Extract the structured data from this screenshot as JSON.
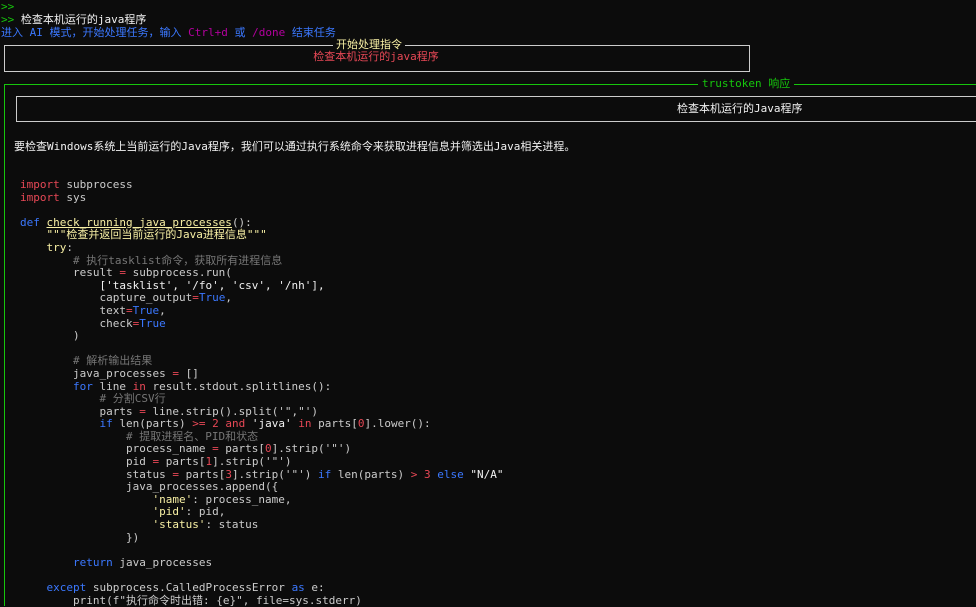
{
  "terminal": {
    "prompt_empty": ">>",
    "prompt_symbol": ">>",
    "user_command": "检查本机运行的java程序",
    "mode_notice_prefix": "进入 AI 模式，开始处理任务，输入 ",
    "mode_notice_key": "Ctrl+d",
    "mode_notice_or": " 或 ",
    "mode_notice_done": "/done",
    "mode_notice_suffix": " 结束任务"
  },
  "instruction_box": {
    "title": "开始处理指令",
    "content": "检查本机运行的java程序"
  },
  "response_panel": {
    "title": "trustoken 响应",
    "heading": "检查本机运行的Java程序",
    "intro": "要检查Windows系统上当前运行的Java程序，我们可以通过执行系统命令来获取进程信息并筛选出Java相关进程。"
  },
  "code": {
    "l1_kw": "import",
    "l1_mod": " subprocess",
    "l2_kw": "import",
    "l2_mod": " sys",
    "l3_kw": "def",
    "l3_fn": "check_running_java_processes",
    "l3_rest": "():",
    "l4_doc": "\"\"\"检查并返回当前运行的Java进程信息\"\"\"",
    "l5_kw": "try",
    "l6_cm": "# 执行tasklist命令，获取所有进程信息",
    "l7_a": "result ",
    "l7_b": " subprocess.run(",
    "l8_a": "['tasklist', '/fo', 'csv', '/nh'],",
    "l9_a": "capture_output",
    "l9_b": "True",
    "l10_a": "text",
    "l10_b": "True",
    "l11_a": "check",
    "l11_b": "True",
    "l12": ")",
    "l13_cm": "# 解析输出结果",
    "l14_a": "java_processes ",
    "l14_b": " []",
    "l15_for": "for",
    "l15_a": " line ",
    "l15_in": "in",
    "l15_b": " result.stdout.splitlines():",
    "l16_cm": "# 分割CSV行",
    "l17_a": "parts ",
    "l17_b": " line.strip().split('\",\"')",
    "l18_if": "if",
    "l18_a": " len(parts) ",
    "l18_num": "2",
    "l18_and": "and",
    "l18_str": "'java'",
    "l18_in": "in",
    "l18_b": " parts[",
    "l18_c": "0",
    "l18_d": "].lower():",
    "l19_cm": "# 提取进程名、PID和状态",
    "l20_a": "process_name ",
    "l20_b": " parts[",
    "l20_c": "0",
    "l20_d": "].strip('\"')",
    "l21_a": "pid ",
    "l21_b": " parts[",
    "l21_c": "1",
    "l21_d": "].strip('\"')",
    "l22_a": "status ",
    "l22_b": " parts[",
    "l22_c": "3",
    "l22_d": "].strip('\"') ",
    "l22_if": "if",
    "l22_e": " len(parts) ",
    "l22_f": "3",
    "l22_else": "else",
    "l22_g": " \"N/A\"",
    "l23_a": "java_processes.append({",
    "l24_k": "'name'",
    "l24_v": ": process_name,",
    "l25_k": "'pid'",
    "l25_v": ": pid,",
    "l26_k": "'status'",
    "l26_v": ": status",
    "l27": "})",
    "l28_kw": "return",
    "l28_a": " java_processes",
    "l29_kw": "except",
    "l29_a": " subprocess.CalledProcessError ",
    "l29_as": "as",
    "l29_b": " e:",
    "l30_a": "print(f\"执行命令时出错: {e}\", file=sys.stderr)"
  },
  "colors": {
    "background": "#0c0c0c",
    "prompt_green": "#16c60c",
    "accent_red": "#e74856",
    "keyword_blue": "#3b78ff",
    "docstring_yellow": "#f9f1a5"
  }
}
